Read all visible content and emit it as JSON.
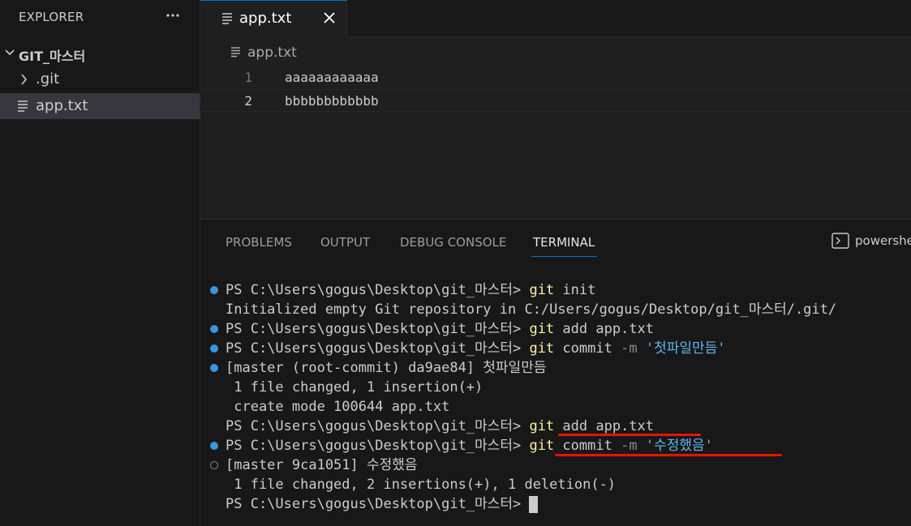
{
  "explorer": {
    "title": "EXPLORER",
    "more_icon": "ellipsis-icon",
    "folder": "GIT_마스터",
    "items": [
      {
        "label": ".git",
        "icon": "chevron-right-icon"
      },
      {
        "label": "app.txt",
        "icon": "file-lines-icon"
      }
    ]
  },
  "tab": {
    "label": "app.txt",
    "close_icon": "close-icon"
  },
  "breadcrumb": {
    "file": "app.txt"
  },
  "editor": {
    "lines": [
      {
        "num": "1",
        "text": "aaaaaaaaaaaa"
      },
      {
        "num": "2",
        "text": "bbbbbbbbbbbb"
      }
    ]
  },
  "panel": {
    "tabs": [
      "PROBLEMS",
      "OUTPUT",
      "DEBUG CONSOLE",
      "TERMINAL"
    ],
    "active_tab": "TERMINAL",
    "shell": "powershe"
  },
  "terminal": {
    "prompt": "PS C:\\Users\\gogus\\Desktop\\git_마스터>",
    "l1": {
      "cmd": "git",
      "rest": "init"
    },
    "l2": "Initialized empty Git repository in C:/Users/gogus/Desktop/git_마스터/.git/",
    "l3": {
      "cmd": "git",
      "rest": "add app.txt"
    },
    "l4": {
      "cmd": "git",
      "rest": "commit",
      "flag": "-m",
      "msg": "'첫파일만듬'"
    },
    "l5": "[master (root-commit) da9ae84] 첫파일만듬",
    "l6": " 1 file changed, 1 insertion(+)",
    "l7": " create mode 100644 app.txt",
    "l8": {
      "cmd": "git",
      "rest": "add app.txt"
    },
    "l9": {
      "cmd": "git",
      "rest": "commit",
      "flag": "-m",
      "msg": "'수정했음'"
    },
    "l10": "[master 9ca1051] 수정했음",
    "l11": " 1 file changed, 2 insertions(+), 1 deletion(-)"
  },
  "colors": {
    "accent": "#0078d4",
    "annotation_red": "#e51400",
    "command_yellow": "#f9f1a5",
    "string_blue": "#61b6ef",
    "success_dot": "#3a96dd"
  }
}
